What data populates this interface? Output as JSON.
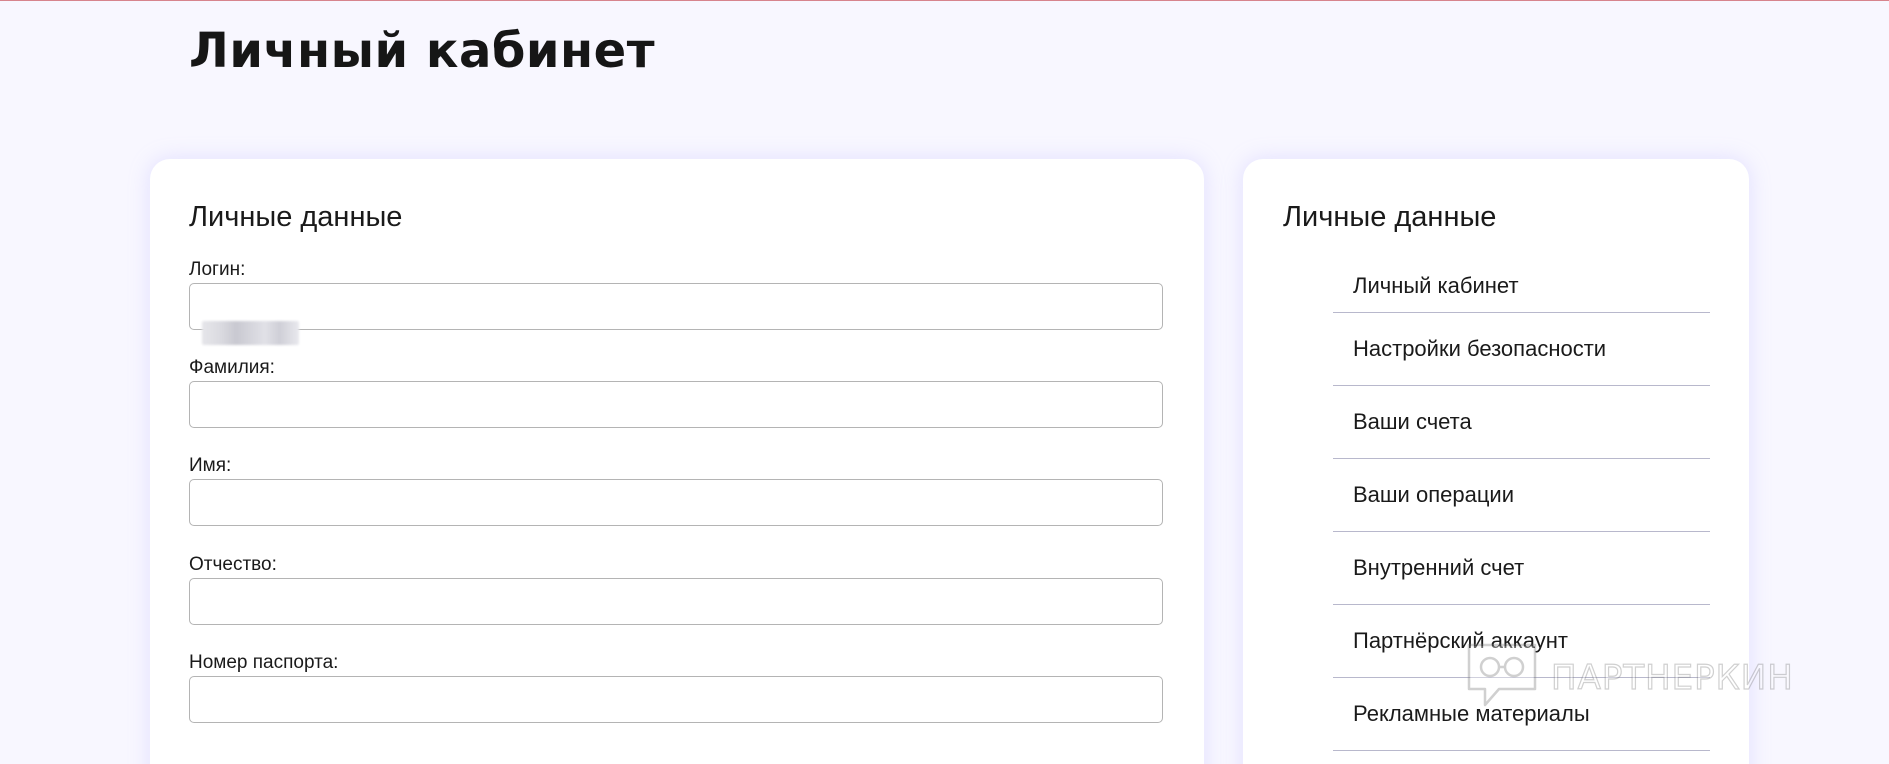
{
  "page": {
    "title": "Личный кабинет"
  },
  "form": {
    "title": "Личные данные",
    "fields": [
      {
        "label": "Логин:",
        "value": ""
      },
      {
        "label": "Фамилия:",
        "value": ""
      },
      {
        "label": "Имя:",
        "value": ""
      },
      {
        "label": "Отчество:",
        "value": ""
      },
      {
        "label": "Номер паспорта:",
        "value": ""
      }
    ]
  },
  "sidebar": {
    "title": "Личные данные",
    "items": [
      {
        "label": "Личный кабинет"
      },
      {
        "label": "Настройки безопасности"
      },
      {
        "label": "Ваши счета"
      },
      {
        "label": "Ваши операции"
      },
      {
        "label": "Внутренний счет"
      },
      {
        "label": "Партнёрский аккаунт"
      },
      {
        "label": "Рекламные материалы"
      }
    ]
  },
  "watermark": {
    "text": "ПАРТНЕРКИН",
    "icon": "chat-bubble-glasses-icon"
  },
  "colors": {
    "background": "#f8f7ff",
    "card": "#ffffff",
    "top_border": "#d7848d",
    "divider": "#b8b8cc",
    "input_border": "#b4b4b4"
  }
}
